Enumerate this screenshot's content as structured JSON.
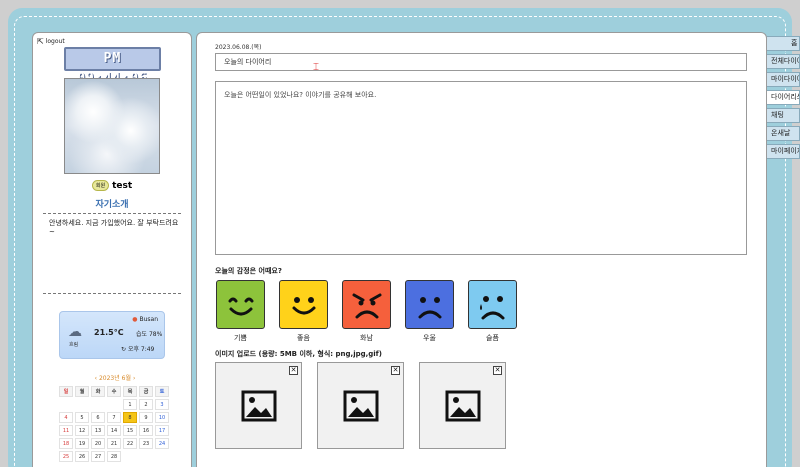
{
  "sidebar": {
    "logout_label": "logout",
    "clock": "PM 09:44:06",
    "badge": "회원",
    "username": "test",
    "intro_title": "자기소개",
    "intro_text": "안녕하세요. 지금 가입했어요. 잘 부탁드려요~",
    "weather": {
      "city": "Busan",
      "desc": "흐림",
      "temp": "21.5°C",
      "humidity": "습도 78%",
      "refresh": "오후 7:49"
    },
    "calendar": {
      "title": "2023년 6월",
      "weekdays": [
        "일",
        "월",
        "화",
        "수",
        "목",
        "금",
        "토"
      ],
      "today": "8",
      "leading_blanks": 4,
      "days": [
        "1",
        "2",
        "3",
        "4",
        "5",
        "6",
        "7",
        "8",
        "9",
        "10",
        "11",
        "12",
        "13",
        "14",
        "15",
        "16",
        "17",
        "18",
        "19",
        "20",
        "21",
        "22",
        "23",
        "24",
        "25",
        "26",
        "27",
        "28"
      ]
    }
  },
  "main": {
    "date": "2023.06.08.(목)",
    "title_placeholder": "오늘의 다이어리",
    "content_placeholder": "오늘은 어떤일이 있었나요? 이야기를 공유해 보아요.",
    "emotion_label": "오늘의 감정은 어때요?",
    "emotions": [
      {
        "name": "기쁨",
        "color": "#8dc33b"
      },
      {
        "name": "좋음",
        "color": "#ffd21a"
      },
      {
        "name": "화남",
        "color": "#f5603c"
      },
      {
        "name": "우울",
        "color": "#4c6fe0"
      },
      {
        "name": "슬픔",
        "color": "#7ecaf0"
      }
    ],
    "upload_label": "이미지 업로드 (용량: 5MB 이하, 형식: png,jpg,gif)"
  },
  "tabs": [
    "홈",
    "전체다이어리",
    "마이다이어리",
    "다이어리쓰기",
    "채팅",
    "온새날",
    "마이페이지"
  ]
}
